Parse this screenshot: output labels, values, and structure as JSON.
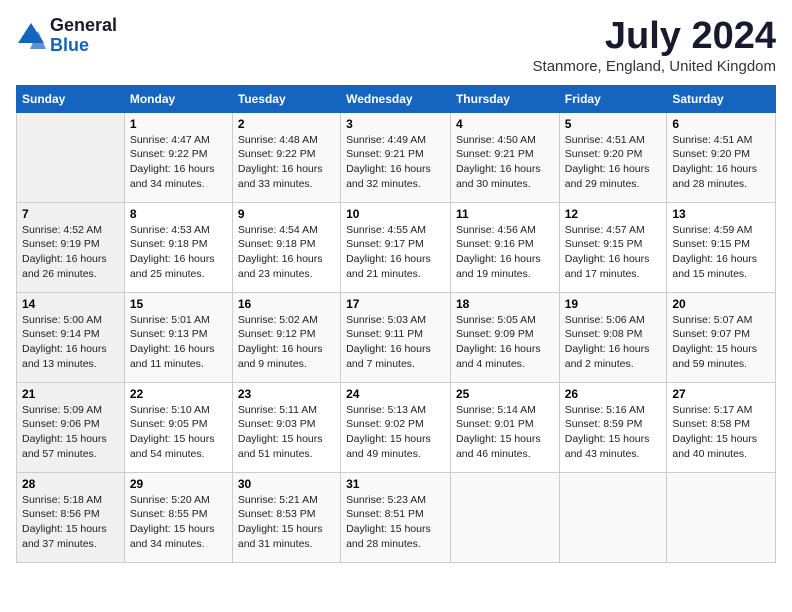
{
  "header": {
    "logo_general": "General",
    "logo_blue": "Blue",
    "month_title": "July 2024",
    "location": "Stanmore, England, United Kingdom"
  },
  "days_of_week": [
    "Sunday",
    "Monday",
    "Tuesday",
    "Wednesday",
    "Thursday",
    "Friday",
    "Saturday"
  ],
  "weeks": [
    [
      {
        "day": "",
        "content": ""
      },
      {
        "day": "1",
        "content": "Sunrise: 4:47 AM\nSunset: 9:22 PM\nDaylight: 16 hours\nand 34 minutes."
      },
      {
        "day": "2",
        "content": "Sunrise: 4:48 AM\nSunset: 9:22 PM\nDaylight: 16 hours\nand 33 minutes."
      },
      {
        "day": "3",
        "content": "Sunrise: 4:49 AM\nSunset: 9:21 PM\nDaylight: 16 hours\nand 32 minutes."
      },
      {
        "day": "4",
        "content": "Sunrise: 4:50 AM\nSunset: 9:21 PM\nDaylight: 16 hours\nand 30 minutes."
      },
      {
        "day": "5",
        "content": "Sunrise: 4:51 AM\nSunset: 9:20 PM\nDaylight: 16 hours\nand 29 minutes."
      },
      {
        "day": "6",
        "content": "Sunrise: 4:51 AM\nSunset: 9:20 PM\nDaylight: 16 hours\nand 28 minutes."
      }
    ],
    [
      {
        "day": "7",
        "content": "Sunrise: 4:52 AM\nSunset: 9:19 PM\nDaylight: 16 hours\nand 26 minutes."
      },
      {
        "day": "8",
        "content": "Sunrise: 4:53 AM\nSunset: 9:18 PM\nDaylight: 16 hours\nand 25 minutes."
      },
      {
        "day": "9",
        "content": "Sunrise: 4:54 AM\nSunset: 9:18 PM\nDaylight: 16 hours\nand 23 minutes."
      },
      {
        "day": "10",
        "content": "Sunrise: 4:55 AM\nSunset: 9:17 PM\nDaylight: 16 hours\nand 21 minutes."
      },
      {
        "day": "11",
        "content": "Sunrise: 4:56 AM\nSunset: 9:16 PM\nDaylight: 16 hours\nand 19 minutes."
      },
      {
        "day": "12",
        "content": "Sunrise: 4:57 AM\nSunset: 9:15 PM\nDaylight: 16 hours\nand 17 minutes."
      },
      {
        "day": "13",
        "content": "Sunrise: 4:59 AM\nSunset: 9:15 PM\nDaylight: 16 hours\nand 15 minutes."
      }
    ],
    [
      {
        "day": "14",
        "content": "Sunrise: 5:00 AM\nSunset: 9:14 PM\nDaylight: 16 hours\nand 13 minutes."
      },
      {
        "day": "15",
        "content": "Sunrise: 5:01 AM\nSunset: 9:13 PM\nDaylight: 16 hours\nand 11 minutes."
      },
      {
        "day": "16",
        "content": "Sunrise: 5:02 AM\nSunset: 9:12 PM\nDaylight: 16 hours\nand 9 minutes."
      },
      {
        "day": "17",
        "content": "Sunrise: 5:03 AM\nSunset: 9:11 PM\nDaylight: 16 hours\nand 7 minutes."
      },
      {
        "day": "18",
        "content": "Sunrise: 5:05 AM\nSunset: 9:09 PM\nDaylight: 16 hours\nand 4 minutes."
      },
      {
        "day": "19",
        "content": "Sunrise: 5:06 AM\nSunset: 9:08 PM\nDaylight: 16 hours\nand 2 minutes."
      },
      {
        "day": "20",
        "content": "Sunrise: 5:07 AM\nSunset: 9:07 PM\nDaylight: 15 hours\nand 59 minutes."
      }
    ],
    [
      {
        "day": "21",
        "content": "Sunrise: 5:09 AM\nSunset: 9:06 PM\nDaylight: 15 hours\nand 57 minutes."
      },
      {
        "day": "22",
        "content": "Sunrise: 5:10 AM\nSunset: 9:05 PM\nDaylight: 15 hours\nand 54 minutes."
      },
      {
        "day": "23",
        "content": "Sunrise: 5:11 AM\nSunset: 9:03 PM\nDaylight: 15 hours\nand 51 minutes."
      },
      {
        "day": "24",
        "content": "Sunrise: 5:13 AM\nSunset: 9:02 PM\nDaylight: 15 hours\nand 49 minutes."
      },
      {
        "day": "25",
        "content": "Sunrise: 5:14 AM\nSunset: 9:01 PM\nDaylight: 15 hours\nand 46 minutes."
      },
      {
        "day": "26",
        "content": "Sunrise: 5:16 AM\nSunset: 8:59 PM\nDaylight: 15 hours\nand 43 minutes."
      },
      {
        "day": "27",
        "content": "Sunrise: 5:17 AM\nSunset: 8:58 PM\nDaylight: 15 hours\nand 40 minutes."
      }
    ],
    [
      {
        "day": "28",
        "content": "Sunrise: 5:18 AM\nSunset: 8:56 PM\nDaylight: 15 hours\nand 37 minutes."
      },
      {
        "day": "29",
        "content": "Sunrise: 5:20 AM\nSunset: 8:55 PM\nDaylight: 15 hours\nand 34 minutes."
      },
      {
        "day": "30",
        "content": "Sunrise: 5:21 AM\nSunset: 8:53 PM\nDaylight: 15 hours\nand 31 minutes."
      },
      {
        "day": "31",
        "content": "Sunrise: 5:23 AM\nSunset: 8:51 PM\nDaylight: 15 hours\nand 28 minutes."
      },
      {
        "day": "",
        "content": ""
      },
      {
        "day": "",
        "content": ""
      },
      {
        "day": "",
        "content": ""
      }
    ]
  ]
}
